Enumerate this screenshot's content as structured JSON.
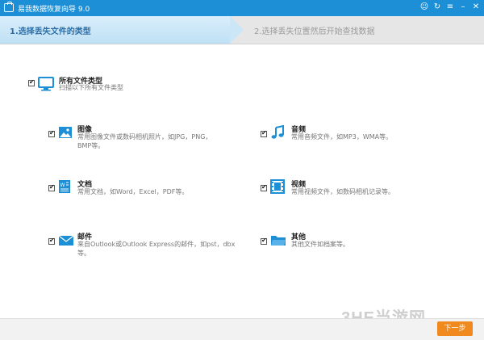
{
  "window": {
    "title": "易我数据恢复向导 9.0"
  },
  "steps": {
    "step1": "1.选择丢失文件的类型",
    "step2": "2.选择丢失位置然后开始查找数据"
  },
  "all": {
    "title": "所有文件类型",
    "desc": "扫描以下所有文件类型"
  },
  "types": {
    "image": {
      "title": "图像",
      "desc1": "常用图像文件或数码相机照片，如JPG，PNG，",
      "desc2": "BMP等。"
    },
    "audio": {
      "title": "音频",
      "desc1": "常用音频文件，如MP3，WMA等。"
    },
    "doc": {
      "title": "文档",
      "desc1": "常用文档，如Word，Excel，PDF等。"
    },
    "video": {
      "title": "视频",
      "desc1": "常用视频文件，如数码相机记录等。"
    },
    "mail": {
      "title": "邮件",
      "desc1": "来自Outlook或Outlook Express的邮件，如pst，dbx",
      "desc2": "等。"
    },
    "other": {
      "title": "其他",
      "desc1": "其他文件如档案等。"
    }
  },
  "footer": {
    "next": "下一步",
    "watermark": "3HE当游网"
  }
}
